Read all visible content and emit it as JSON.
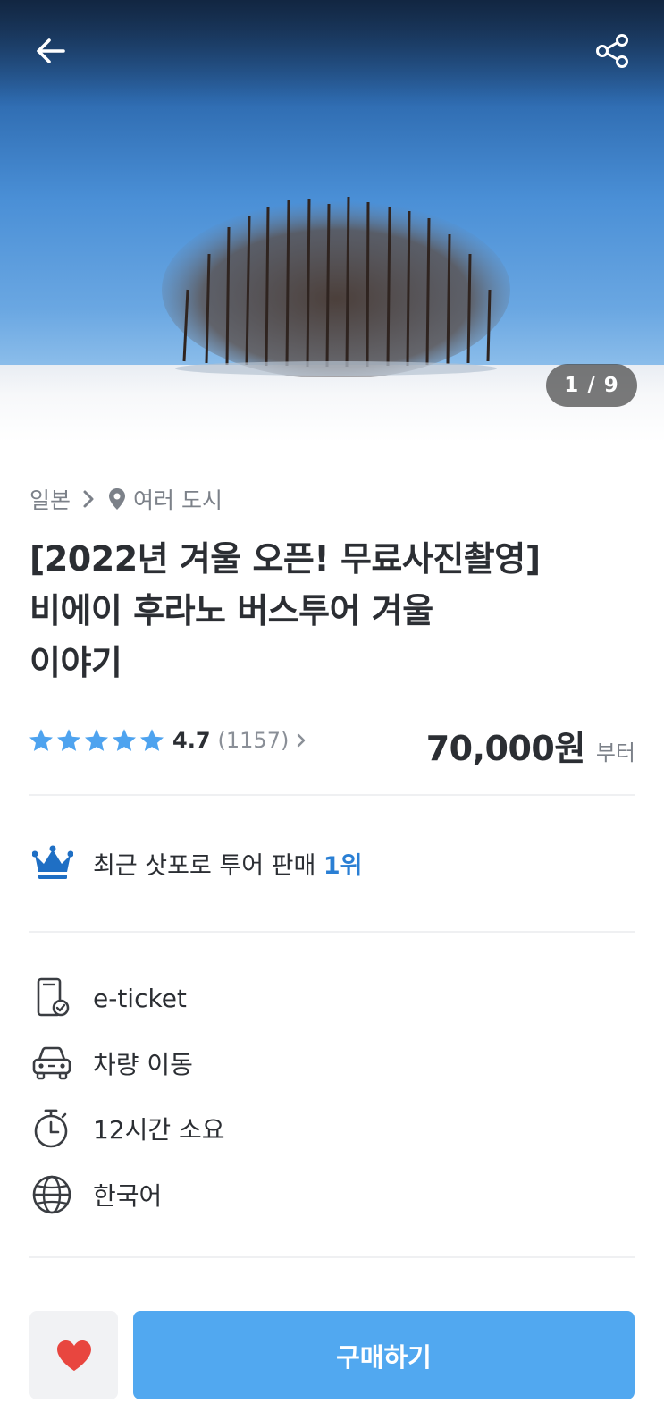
{
  "hero": {
    "counter": "1 / 9",
    "back_icon": "arrow-left-icon",
    "share_icon": "share-icon"
  },
  "breadcrumb": {
    "country": "일본",
    "location": "여러 도시"
  },
  "product": {
    "title_line1": "[2022년 겨울 오픈! 무료사진촬영]",
    "title_line2": "비에이 후라노 버스투어 겨울",
    "title_line3": "이야기",
    "rating": "4.7",
    "rating_fraction": 0.94,
    "review_count": "(1157)",
    "price": "70,000원",
    "price_suffix": "부터"
  },
  "rank": {
    "text": "최근 삿포로 투어 판매 ",
    "highlight": "1위",
    "icon": "crown-icon"
  },
  "features": [
    {
      "label": "e-ticket",
      "icon": "mobile-ticket-icon"
    },
    {
      "label": "차량 이동",
      "icon": "car-icon"
    },
    {
      "label": "12시간 소요",
      "icon": "stopwatch-icon"
    },
    {
      "label": "한국어",
      "icon": "globe-icon"
    }
  ],
  "actions": {
    "buy_label": "구매하기",
    "like_icon": "heart-icon"
  },
  "colors": {
    "accent": "#51a8f0",
    "star": "#4ea3ef",
    "highlight": "#2a7fd4",
    "heart": "#e8463f",
    "crown": "#1f6fc4"
  }
}
